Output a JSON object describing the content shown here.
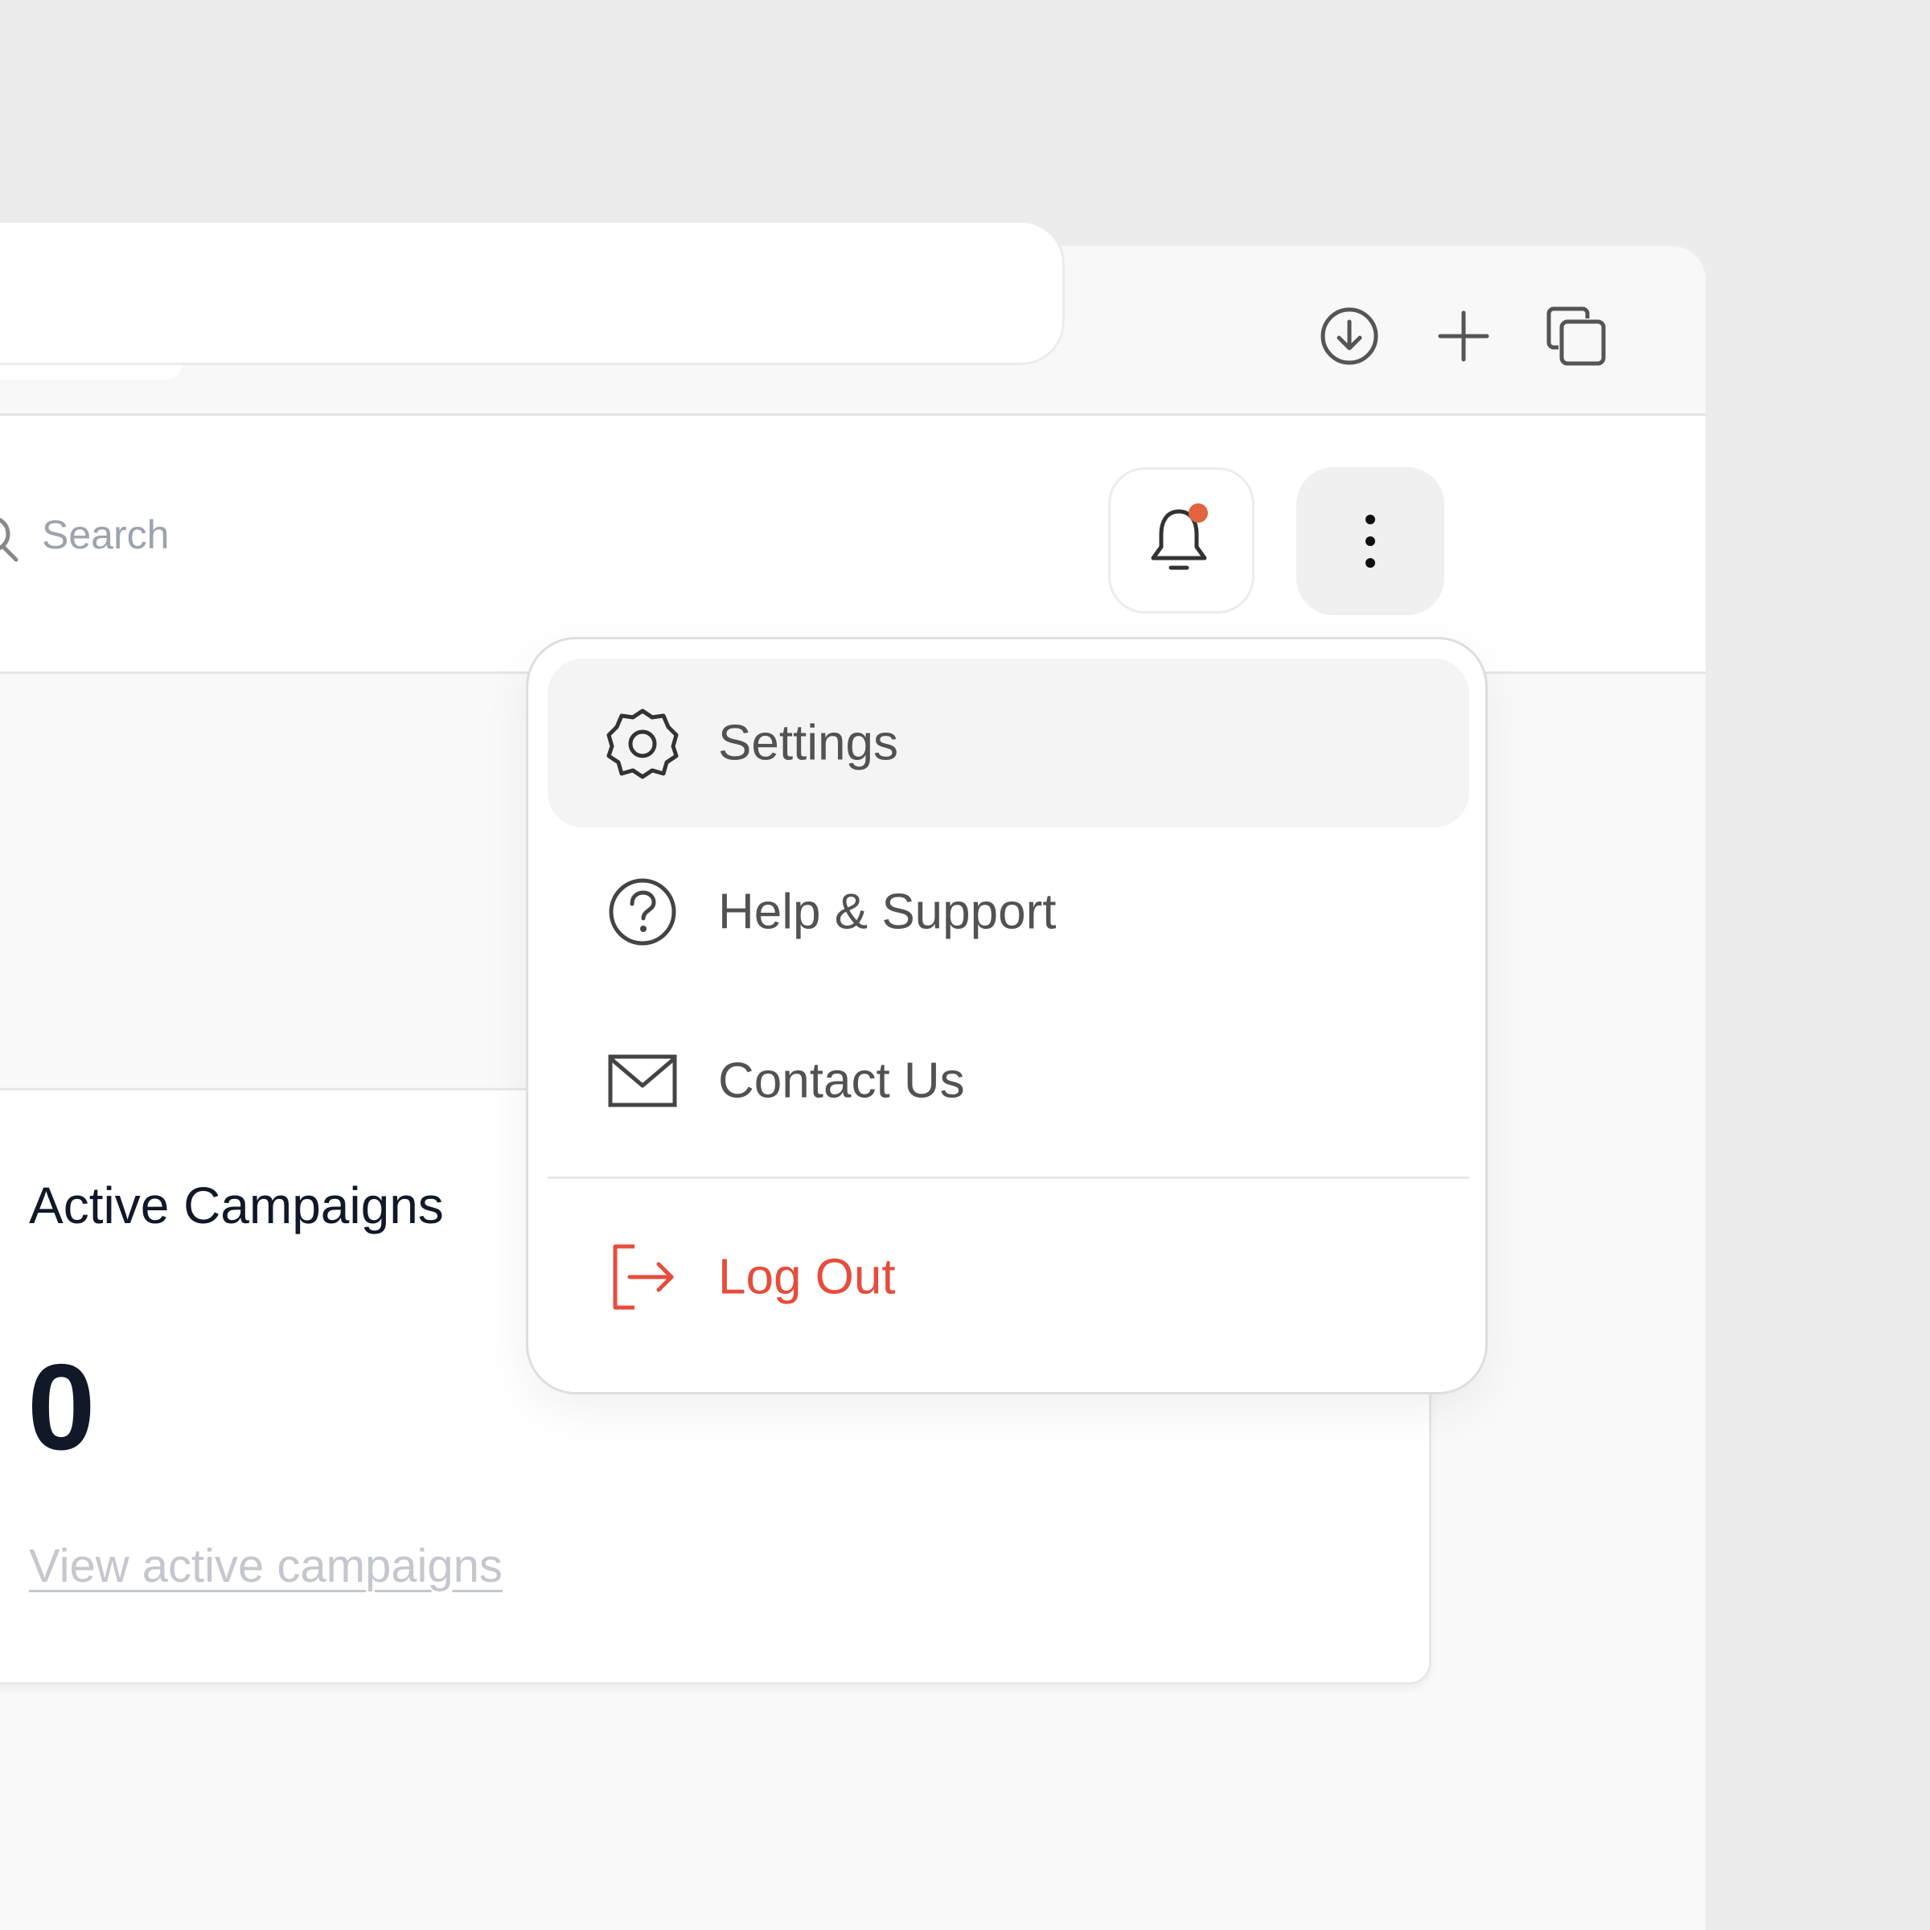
{
  "browser": {
    "toolbar": {
      "reload_icon": "reload-icon",
      "download_icon": "download-icon",
      "new_tab_icon": "plus-icon",
      "tabs_icon": "tabs-icon"
    }
  },
  "header": {
    "search": {
      "placeholder": "Search"
    },
    "notifications": {
      "has_unread": true,
      "badge_color": "#e2643f"
    },
    "more_menu_icon": "vertical-dots-icon"
  },
  "card": {
    "title": "Active Campaigns",
    "value": "0",
    "link": "View active campaigns"
  },
  "menu": {
    "items": [
      {
        "label": "Settings",
        "icon": "gear-icon",
        "active": true
      },
      {
        "label": "Help & Support",
        "icon": "help-circle-icon"
      },
      {
        "label": "Contact Us",
        "icon": "mail-icon"
      }
    ],
    "logout": {
      "label": "Log Out",
      "icon": "logout-icon",
      "color": "#e74c3c"
    }
  }
}
